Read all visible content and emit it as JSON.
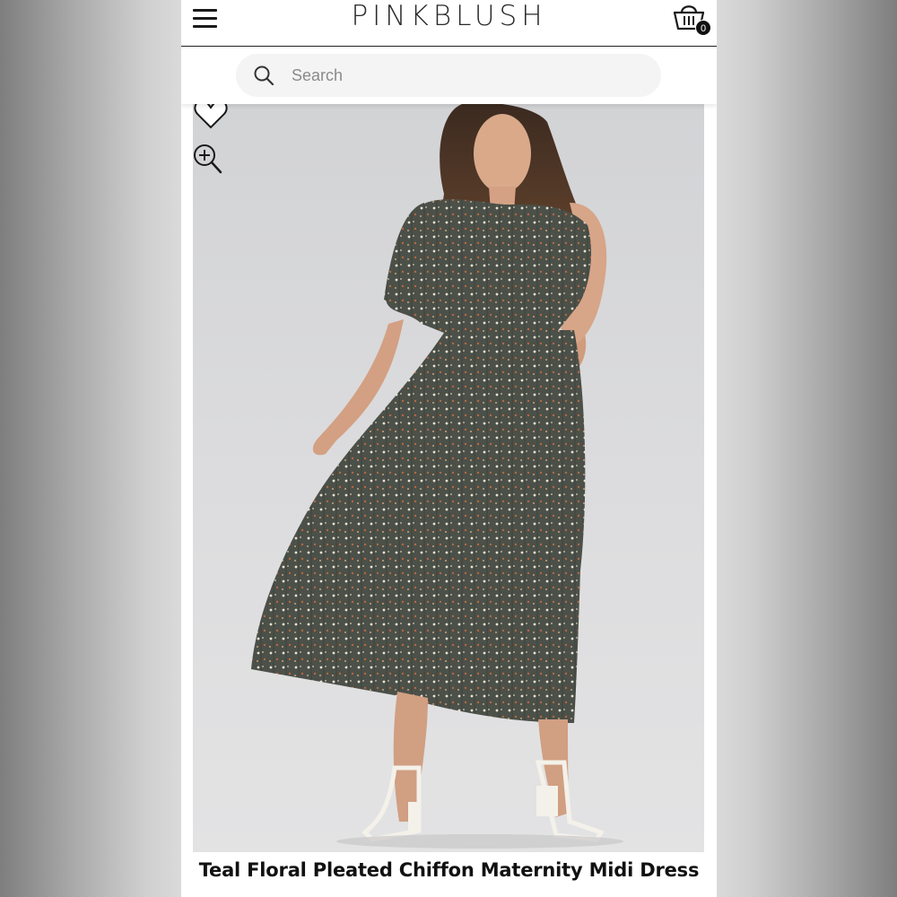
{
  "header": {
    "brand": "PINKBLUSH",
    "cart_count": "0"
  },
  "search": {
    "placeholder": "Search"
  },
  "product": {
    "title": "Teal Floral Pleated Chiffon Maternity Midi Dress"
  },
  "icons": {
    "menu": "hamburger-menu-icon",
    "cart": "shopping-basket-icon",
    "search": "search-icon",
    "wishlist": "heart-icon",
    "zoom": "zoom-in-icon"
  },
  "colors": {
    "brand_text": "#2a2a2a",
    "dress": "#4b5049",
    "background_photo": "#d8d8da"
  }
}
